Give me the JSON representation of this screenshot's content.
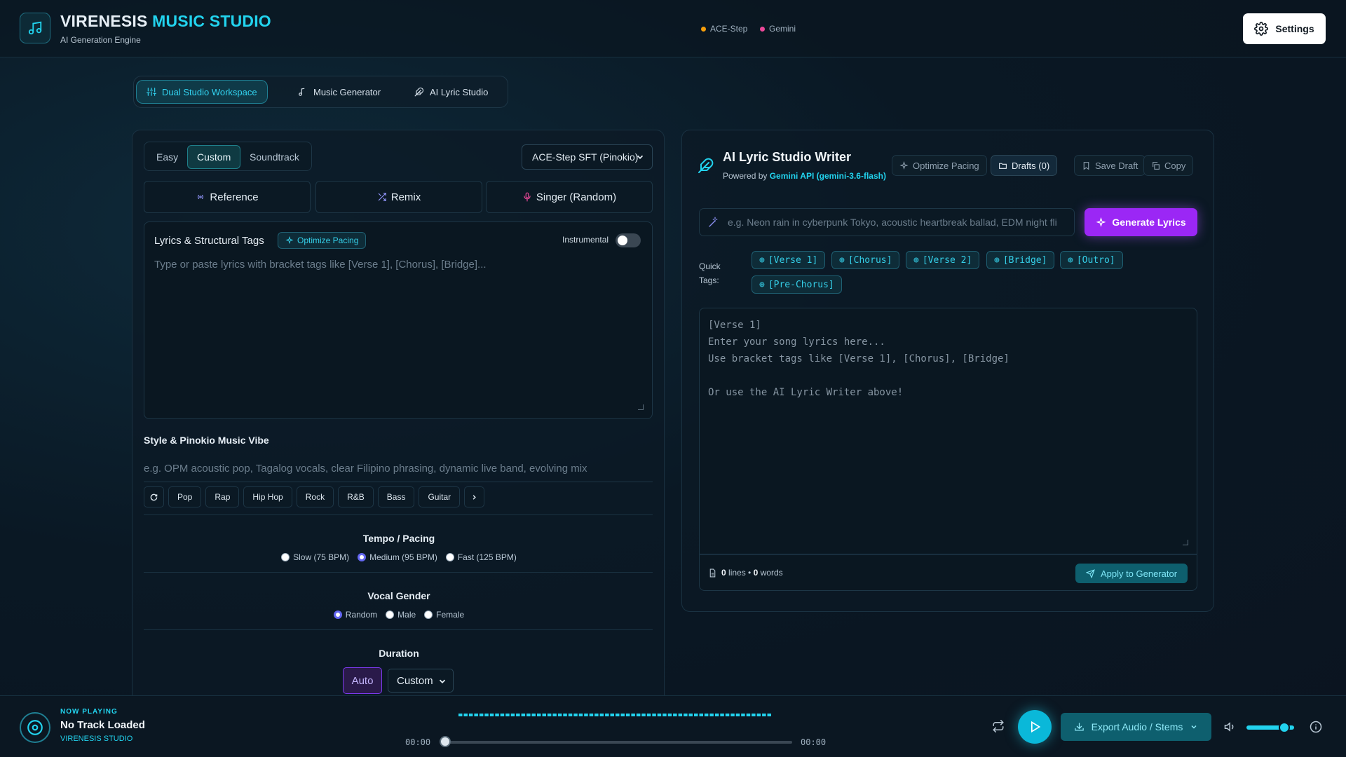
{
  "app": {
    "brand_main": "VIRENESIS",
    "brand_accent": "MUSIC STUDIO",
    "brand_sub": "AI Generation Engine",
    "status": [
      {
        "label": "ACE-Step",
        "color": "#f59e0b"
      },
      {
        "label": "Gemini",
        "color": "#ec4899"
      }
    ],
    "settings_label": "Settings"
  },
  "mode_tabs": [
    {
      "label": "Dual Studio Workspace",
      "icon": "sliders-icon",
      "active": true
    },
    {
      "label": "Music Generator",
      "icon": "music-note-icon",
      "active": false
    },
    {
      "label": "AI Lyric Studio",
      "icon": "feather-icon",
      "active": false
    }
  ],
  "generator": {
    "modes": [
      "Easy",
      "Custom",
      "Soundtrack"
    ],
    "active_mode": "Custom",
    "model_selected": "ACE-Step SFT (Pinokio)",
    "options": [
      {
        "label": "Reference",
        "icon": "broadcast-icon"
      },
      {
        "label": "Remix",
        "icon": "shuffle-icon"
      },
      {
        "label": "Singer (Random)",
        "icon": "mic-icon"
      }
    ],
    "lyrics_title": "Lyrics & Structural Tags",
    "optimize_label": "Optimize Pacing",
    "instrumental_label": "Instrumental",
    "instrumental_on": false,
    "lyrics_placeholder": "Type or paste lyrics with bracket tags like [Verse 1], [Chorus], [Bridge]...",
    "style_title": "Style & Pinokio Music Vibe",
    "style_placeholder": "e.g. OPM acoustic pop, Tagalog vocals, clear Filipino phrasing, dynamic live band, evolving mix",
    "style_chips": [
      "Pop",
      "Rap",
      "Hip Hop",
      "Rock",
      "R&B",
      "Bass",
      "Guitar"
    ],
    "tempo_title": "Tempo / Pacing",
    "tempo_options": [
      "Slow (75 BPM)",
      "Medium (95 BPM)",
      "Fast (125 BPM)"
    ],
    "tempo_selected": 1,
    "vocal_title": "Vocal Gender",
    "vocal_options": [
      "Random",
      "Male",
      "Female"
    ],
    "vocal_selected": 0,
    "duration_title": "Duration",
    "duration_auto": "Auto",
    "duration_custom": "Custom"
  },
  "lyric_studio": {
    "title": "AI Lyric Studio Writer",
    "powered_prefix": "Powered by",
    "powered_api": "Gemini API (gemini-3.6-flash)",
    "tools": [
      "Optimize Pacing",
      "Drafts (0)",
      "Save Draft",
      "Copy"
    ],
    "prompt_placeholder": "e.g. Neon rain in cyberpunk Tokyo, acoustic heartbreak ballad, EDM night fli",
    "generate_label": "Generate Lyrics",
    "quick_tags_label": "Quick Tags:",
    "quick_tags": [
      "[Verse 1]",
      "[Chorus]",
      "[Verse 2]",
      "[Bridge]",
      "[Outro]",
      "[Pre-Chorus]"
    ],
    "editor_placeholder": "[Verse 1]\nEnter your song lyrics here...\nUse bracket tags like [Verse 1], [Chorus], [Bridge]\n\nOr use the AI Lyric Writer above!",
    "lines_count": "0",
    "lines_label": "lines",
    "words_count": "0",
    "words_label": "words",
    "apply_label": "Apply to Generator"
  },
  "player": {
    "now_playing_label": "NOW PLAYING",
    "track_title": "No Track Loaded",
    "artist": "VIRENESIS STUDIO",
    "time_current": "00:00",
    "time_total": "00:00",
    "progress": 0,
    "export_label": "Export Audio / Stems",
    "volume": 0.8
  }
}
